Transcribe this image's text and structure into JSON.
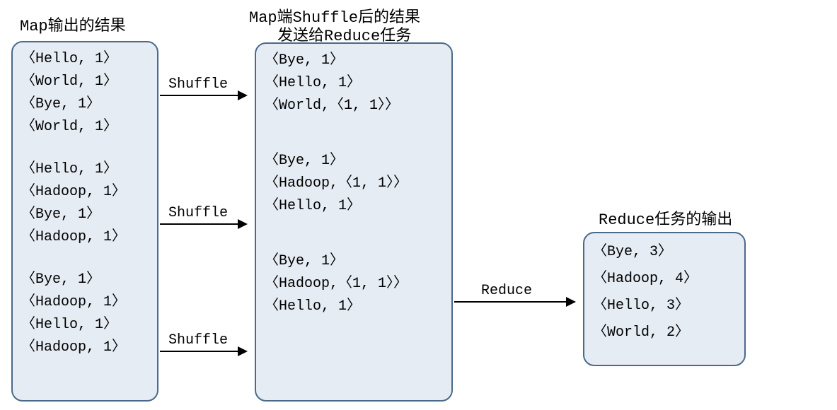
{
  "titles": {
    "map": "Map输出的结果",
    "shuffle_l1": "Map端Shuffle后的结果",
    "shuffle_l2": "发送给Reduce任务",
    "reduce": "Reduce任务的输出"
  },
  "arrows": {
    "shuffle1": "Shuffle",
    "shuffle2": "Shuffle",
    "shuffle3": "Shuffle",
    "reduce": "Reduce"
  },
  "map_groups": [
    [
      "〈Hello, 1〉",
      "〈World, 1〉",
      "〈Bye, 1〉",
      "〈World, 1〉"
    ],
    [
      "〈Hello, 1〉",
      "〈Hadoop, 1〉",
      "〈Bye, 1〉",
      "〈Hadoop, 1〉"
    ],
    [
      "〈Bye, 1〉",
      "〈Hadoop, 1〉",
      "〈Hello, 1〉",
      "〈Hadoop, 1〉"
    ]
  ],
  "shuffle_groups": [
    [
      "〈Bye, 1〉",
      "〈Hello, 1〉",
      "〈World,〈1, 1〉〉"
    ],
    [
      "〈Bye, 1〉",
      "〈Hadoop,〈1, 1〉〉",
      "〈Hello, 1〉"
    ],
    [
      "〈Bye, 1〉",
      "〈Hadoop,〈1, 1〉〉",
      "〈Hello, 1〉"
    ]
  ],
  "reduce_out": [
    "〈Bye, 3〉",
    "〈Hadoop, 4〉",
    "〈Hello, 3〉",
    "〈World, 2〉"
  ]
}
